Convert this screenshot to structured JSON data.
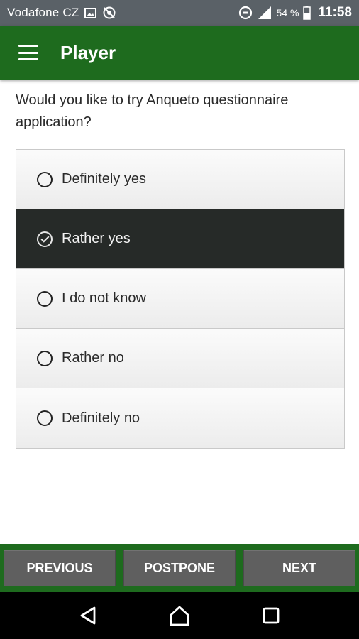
{
  "status_bar": {
    "carrier": "Vodafone CZ",
    "battery_percent": "54 %",
    "time": "11:58",
    "icons": [
      "image-icon",
      "sync-disabled-icon",
      "data-saver-icon",
      "signal-icon",
      "battery-icon"
    ]
  },
  "app_bar": {
    "menu_icon": "menu-icon",
    "title": "Player",
    "color": "#1e6b1e"
  },
  "question": {
    "text": "Would you like to try Anqueto questionnaire application?"
  },
  "options": [
    {
      "label": "Definitely yes",
      "selected": false
    },
    {
      "label": "Rather yes",
      "selected": true
    },
    {
      "label": "I do not know",
      "selected": false
    },
    {
      "label": "Rather no",
      "selected": false
    },
    {
      "label": "Definitely no",
      "selected": false
    }
  ],
  "buttons": {
    "previous": "PREVIOUS",
    "postpone": "POSTPONE",
    "next": "NEXT"
  },
  "nav_bar": {
    "icons": [
      "back-icon",
      "home-icon",
      "recents-icon"
    ]
  }
}
